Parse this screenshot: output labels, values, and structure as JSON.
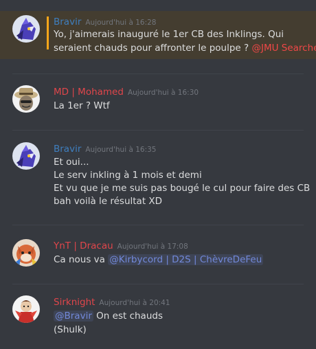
{
  "colors": {
    "background": "#36393f",
    "highlight_bg": "#443d30",
    "highlight_bar": "#faa61a",
    "mention": "#7289da",
    "timestamp": "#72767d",
    "text": "#dcddde"
  },
  "messages": [
    {
      "avatar": "robot-avatar-icon",
      "username": "Bravir",
      "username_color": "#3f7fbf",
      "timestamp": "Aujourd'hui à 16:28",
      "highlighted": true,
      "lines": [
        "Yo, j'aimerais inauguré le 1er CB des Inklings. Qui",
        "seraient chauds pour affronter le poulpe ?"
      ],
      "mention": "@JMU Searcher"
    },
    {
      "avatar": "hat-character-avatar-icon",
      "username": "MD | Mohamed",
      "username_color": "#e0464b",
      "timestamp": "Aujourd'hui à 16:30",
      "lines": [
        "La 1er ? Wtf"
      ]
    },
    {
      "avatar": "robot-avatar-icon",
      "username": "Bravir",
      "username_color": "#3f7fbf",
      "timestamp": "Aujourd'hui à 16:35",
      "lines": [
        "Et oui...",
        "Le serv inkling à 1 mois et demi",
        "Et vu que je me suis pas bougé le cul pour faire des CB",
        "bah voilà le résultat XD"
      ]
    },
    {
      "avatar": "fox-character-avatar-icon",
      "username": "YnT | Dracau",
      "username_color": "#e0464b",
      "timestamp": "Aujourd'hui à 17:08",
      "prefix": "Ca nous va",
      "mention": "@Kirbycord | D2S | ChèvreDeFeu"
    },
    {
      "avatar": "fighter-character-avatar-icon",
      "username": "Sirknight",
      "username_color": "#e0464b",
      "timestamp": "Aujourd'hui à 20:41",
      "mention": "@Bravir",
      "suffix": "On est chauds",
      "lines": [
        "(Shulk)"
      ]
    }
  ]
}
